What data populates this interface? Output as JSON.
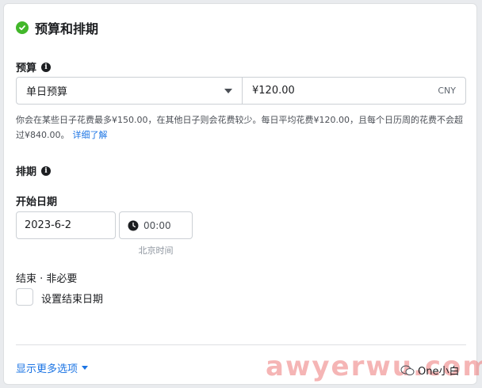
{
  "header": {
    "title": "预算和排期"
  },
  "budget": {
    "label": "预算",
    "info_icon": "i",
    "type_selected": "单日预算",
    "amount": "¥120.00",
    "currency": "CNY",
    "help_text": "你会在某些日子花费最多¥150.00，在其他日子则会花费较少。每日平均花费¥120.00，且每个日历周的花费不会超过¥840.00。",
    "learn_more": "详细了解"
  },
  "schedule": {
    "label": "排期",
    "info_icon": "i",
    "start_label": "开始日期",
    "start_date": "2023-6-2",
    "start_time": "00:00",
    "timezone": "北京时间",
    "end_label": "结束 · 非必要",
    "end_checkbox_label": "设置结束日期",
    "end_checked": false
  },
  "footer": {
    "more_options": "显示更多选项"
  },
  "watermark": {
    "text": "awyerwu.com",
    "brand": "One小白"
  },
  "colors": {
    "accent": "#1b74e4",
    "success": "#42b72a"
  }
}
